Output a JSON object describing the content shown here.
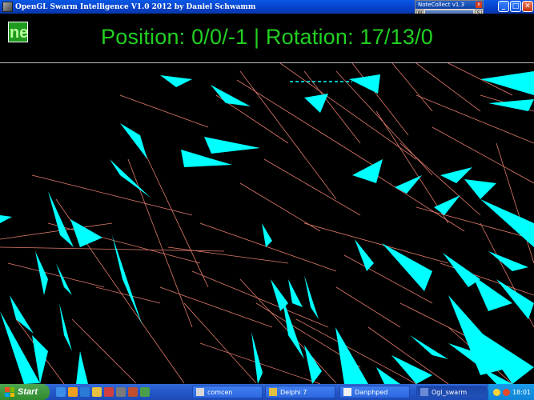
{
  "window": {
    "title": "OpenGL Swarm Intelligence V1.0 2012 by Daniel Schwamm",
    "minimize_glyph": "_",
    "maximize_glyph": "□",
    "close_glyph": "✕"
  },
  "notecollect": {
    "title": "NoteCollect v1.3",
    "close_glyph": "x",
    "left_button": "W",
    "right_button": "S"
  },
  "hud": {
    "logo_text": "ne",
    "readout": "Position: 0/0/-1 | Rotation: 17/13/0"
  },
  "colors": {
    "agent": "#00ffff",
    "trail": "#e07a6a",
    "readout": "#22d022",
    "background": "#000000"
  },
  "taskbar": {
    "start_label": "Start",
    "quick_launch_icons": [
      "ie-icon",
      "media-icon",
      "explorer-icon",
      "folder-icon",
      "delphi-icon",
      "settings-icon",
      "tools-icon",
      "edit-icon"
    ],
    "tasks": [
      {
        "label": "comcen",
        "icon": "window-icon",
        "active": false
      },
      {
        "label": "Delphi 7",
        "icon": "delphi-icon",
        "active": false
      },
      {
        "label": "Danphped",
        "icon": "editor-icon",
        "active": false
      },
      {
        "label": "Ogl_swarm",
        "icon": "app-icon",
        "active": true
      }
    ],
    "clock": "18:01"
  }
}
